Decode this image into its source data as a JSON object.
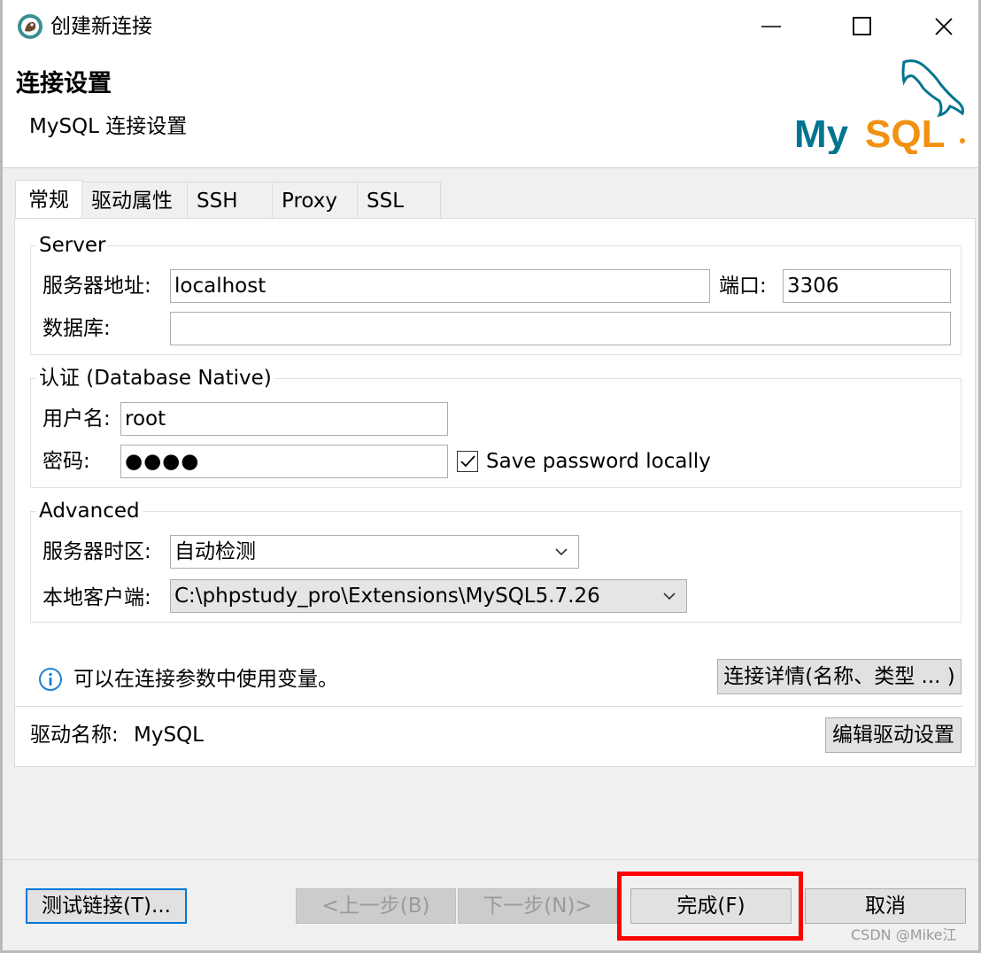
{
  "window": {
    "title": "创建新连接"
  },
  "header": {
    "title": "连接设置",
    "subtitle": "MySQL 连接设置",
    "logo_text": "MySQL"
  },
  "tabs": [
    {
      "label": "常规",
      "active": true
    },
    {
      "label": "驱动属性",
      "active": false
    },
    {
      "label": "SSH",
      "active": false
    },
    {
      "label": "Proxy",
      "active": false
    },
    {
      "label": "SSL",
      "active": false
    }
  ],
  "server": {
    "legend": "Server",
    "host_label": "服务器地址:",
    "host_value": "localhost",
    "port_label": "端口:",
    "port_value": "3306",
    "database_label": "数据库:",
    "database_value": ""
  },
  "auth": {
    "legend": "认证 (Database Native)",
    "username_label": "用户名:",
    "username_value": "root",
    "password_label": "密码:",
    "password_value": "●●●●",
    "save_password_label": "Save password locally",
    "save_password_checked": true
  },
  "advanced": {
    "legend": "Advanced",
    "timezone_label": "服务器时区:",
    "timezone_value": "自动检测",
    "client_label": "本地客户端:",
    "client_value": "C:\\phpstudy_pro\\Extensions\\MySQL5.7.26"
  },
  "info": {
    "text": "可以在连接参数中使用变量。",
    "details_button": "连接详情(名称、类型 ... )"
  },
  "driver": {
    "label": "驱动名称:",
    "name": "MySQL",
    "edit_button": "编辑驱动设置"
  },
  "footer": {
    "test_button": "测试链接(T)...",
    "back_button": "<上一步(B)",
    "next_button": "下一步(N)>",
    "finish_button": "完成(F)",
    "cancel_button": "取消"
  },
  "watermark": "CSDN @Mike江",
  "colors": {
    "highlight": "#ff0000",
    "focus_border": "#0078d7",
    "info_icon": "#1f7fd1",
    "mysql_teal": "#00758f",
    "mysql_orange": "#f29111"
  }
}
